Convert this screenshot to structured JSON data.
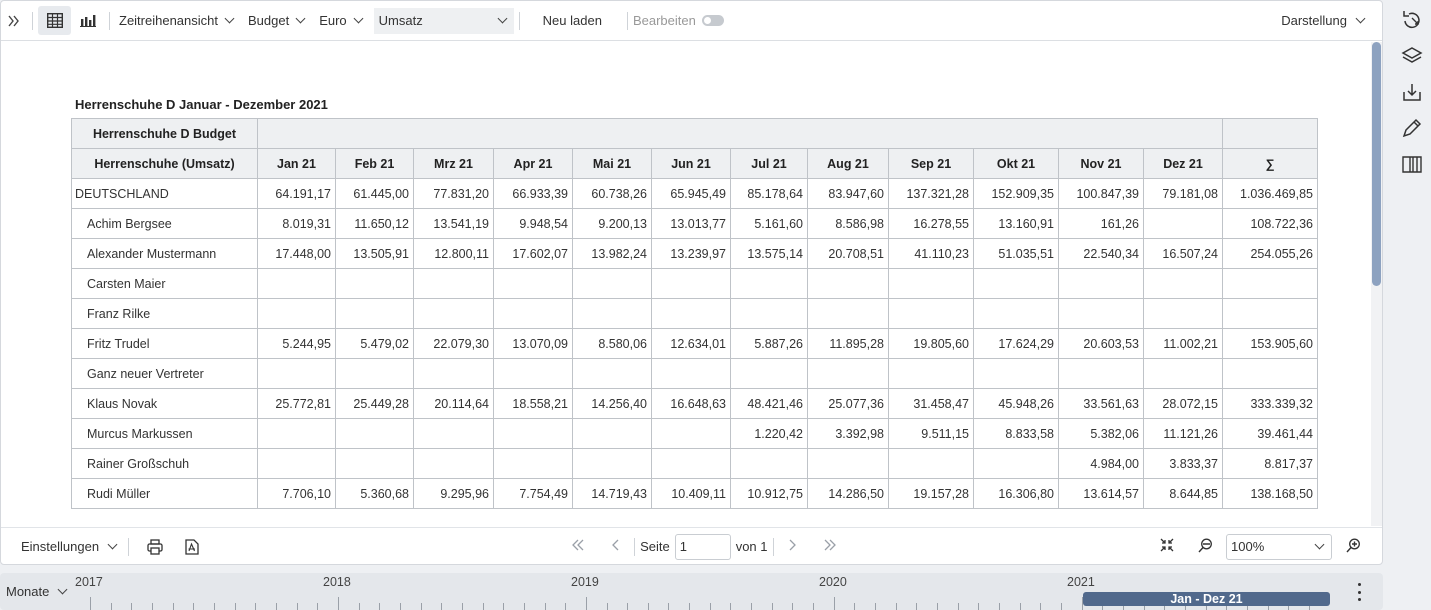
{
  "toolbar": {
    "view_label": "Zeitreihenansicht",
    "budget_label": "Budget",
    "currency_label": "Euro",
    "measure_value": "Umsatz",
    "reload_label": "Neu laden",
    "edit_label": "Bearbeiten",
    "display_label": "Darstellung"
  },
  "report": {
    "title": "Herrenschuhe D Januar - Dezember 2021",
    "header1": "Herrenschuhe D Budget",
    "header2": "Herrenschuhe (Umsatz)",
    "months": [
      "Jan 21",
      "Feb 21",
      "Mrz 21",
      "Apr 21",
      "Mai 21",
      "Jun 21",
      "Jul 21",
      "Aug 21",
      "Sep 21",
      "Okt 21",
      "Nov 21",
      "Dez 21",
      "∑"
    ],
    "rows": [
      {
        "label": "DEUTSCHLAND",
        "values": [
          "64.191,17",
          "61.445,00",
          "77.831,20",
          "66.933,39",
          "60.738,26",
          "65.945,49",
          "85.178,64",
          "83.947,60",
          "137.321,28",
          "152.909,35",
          "100.847,39",
          "79.181,08",
          "1.036.469,85"
        ]
      },
      {
        "label": "Achim Bergsee",
        "values": [
          "8.019,31",
          "11.650,12",
          "13.541,19",
          "9.948,54",
          "9.200,13",
          "13.013,77",
          "5.161,60",
          "8.586,98",
          "16.278,55",
          "13.160,91",
          "161,26",
          "",
          "108.722,36"
        ]
      },
      {
        "label": "Alexander Mustermann",
        "values": [
          "17.448,00",
          "13.505,91",
          "12.800,11",
          "17.602,07",
          "13.982,24",
          "13.239,97",
          "13.575,14",
          "20.708,51",
          "41.110,23",
          "51.035,51",
          "22.540,34",
          "16.507,24",
          "254.055,26"
        ]
      },
      {
        "label": "Carsten Maier",
        "values": [
          "",
          "",
          "",
          "",
          "",
          "",
          "",
          "",
          "",
          "",
          "",
          "",
          ""
        ]
      },
      {
        "label": "Franz Rilke",
        "values": [
          "",
          "",
          "",
          "",
          "",
          "",
          "",
          "",
          "",
          "",
          "",
          "",
          ""
        ]
      },
      {
        "label": "Fritz Trudel",
        "values": [
          "5.244,95",
          "5.479,02",
          "22.079,30",
          "13.070,09",
          "8.580,06",
          "12.634,01",
          "5.887,26",
          "11.895,28",
          "19.805,60",
          "17.624,29",
          "20.603,53",
          "11.002,21",
          "153.905,60"
        ]
      },
      {
        "label": "Ganz neuer Vertreter",
        "values": [
          "",
          "",
          "",
          "",
          "",
          "",
          "",
          "",
          "",
          "",
          "",
          "",
          ""
        ]
      },
      {
        "label": "Klaus Novak",
        "values": [
          "25.772,81",
          "25.449,28",
          "20.114,64",
          "18.558,21",
          "14.256,40",
          "16.648,63",
          "48.421,46",
          "25.077,36",
          "31.458,47",
          "45.948,26",
          "33.561,63",
          "28.072,15",
          "333.339,32"
        ]
      },
      {
        "label": "Murcus Markussen",
        "values": [
          "",
          "",
          "",
          "",
          "",
          "",
          "1.220,42",
          "3.392,98",
          "9.511,15",
          "8.833,58",
          "5.382,06",
          "11.121,26",
          "39.461,44"
        ]
      },
      {
        "label": "Rainer Großschuh",
        "values": [
          "",
          "",
          "",
          "",
          "",
          "",
          "",
          "",
          "",
          "",
          "4.984,00",
          "3.833,37",
          "8.817,37"
        ]
      },
      {
        "label": "Rudi Müller",
        "values": [
          "7.706,10",
          "5.360,68",
          "9.295,96",
          "7.754,49",
          "14.719,43",
          "10.409,11",
          "10.912,75",
          "14.286,50",
          "19.157,28",
          "16.306,80",
          "13.614,57",
          "8.644,85",
          "138.168,50"
        ]
      }
    ]
  },
  "bottombar": {
    "settings_label": "Einstellungen",
    "page_label": "Seite",
    "page_value": "1",
    "of_label": "von 1",
    "zoom_value": "100%"
  },
  "timeline": {
    "unit_label": "Monate",
    "years": [
      "2017",
      "2018",
      "2019",
      "2020",
      "2021"
    ],
    "range_label": "Jan - Dez 21"
  },
  "colors": {
    "accent": "#51698c",
    "scroll_thumb": "#8da2c0",
    "header_bg": "#eef0f2"
  }
}
